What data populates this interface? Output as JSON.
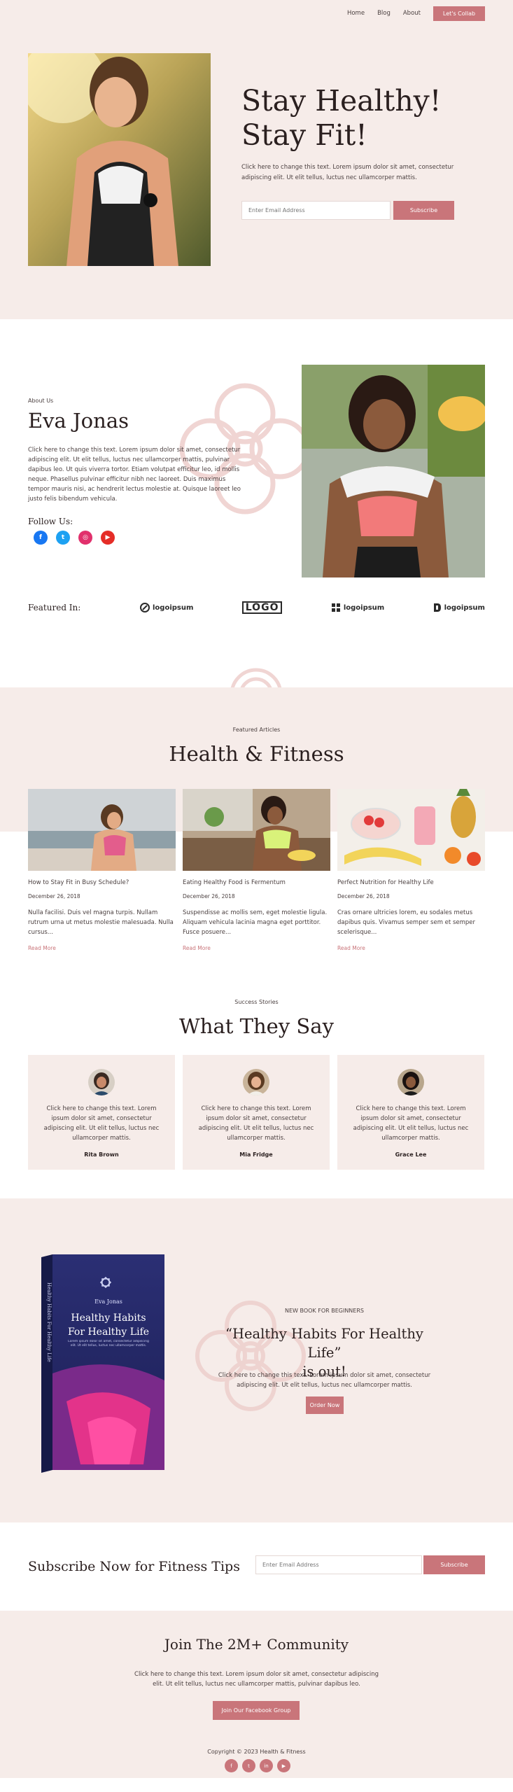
{
  "nav": {
    "links": [
      "Home",
      "Blog",
      "About"
    ],
    "cta": "Let's Collab"
  },
  "hero": {
    "title_line1": "Stay Healthy!",
    "title_line2": "Stay Fit!",
    "text": "Click here to change this text. Lorem ipsum dolor sit amet, consectetur adipiscing elit. Ut elit tellus, luctus nec ullamcorper mattis.",
    "email_placeholder": "Enter Email Address",
    "subscribe": "Subscribe"
  },
  "about": {
    "eyebrow": "About Us",
    "name": "Eva Jonas",
    "text": "Click here to change this text. Lorem ipsum dolor sit amet, consectetur adipiscing elit. Ut elit tellus, luctus nec ullamcorper mattis, pulvinar dapibus leo. Ut quis viverra tortor. Etiam volutpat efficitur leo, id mollis neque. Phasellus pulvinar efficitur nibh nec laoreet. Duis maximus tempor mauris nisi, ac hendrerit lectus molestie at. Quisque laoreet leo justo felis bibendum vehicula.",
    "follow": "Follow Us:",
    "socials": [
      {
        "icon": "facebook-icon",
        "glyph": "f",
        "color": "#1877f2"
      },
      {
        "icon": "twitter-icon",
        "glyph": "t",
        "color": "#1da1f2"
      },
      {
        "icon": "instagram-icon",
        "glyph": "◎",
        "color": "#e1306c"
      },
      {
        "icon": "youtube-icon",
        "glyph": "▶",
        "color": "#e52d27"
      }
    ]
  },
  "featured": {
    "label": "Featured In:",
    "logos": [
      "logoipsum",
      "LOGO",
      "logoipsum",
      "logoipsum"
    ]
  },
  "articles": {
    "eyebrow": "Featured Articles",
    "title": "Health & Fitness",
    "items": [
      {
        "title": "How to Stay Fit in Busy Schedule?",
        "date": "December 26, 2018",
        "excerpt": "Nulla facilisi. Duis vel magna turpis. Nullam rutrum urna ut metus molestie malesuada. Nulla cursus...",
        "more": "Read More"
      },
      {
        "title": "Eating Healthy Food is Fermentum",
        "date": "December 26, 2018",
        "excerpt": "Suspendisse ac mollis sem, eget molestie ligula. Aliquam vehicula lacinia magna eget porttitor. Fusce posuere...",
        "more": "Read More"
      },
      {
        "title": "Perfect Nutrition for Healthy Life",
        "date": "December 26, 2018",
        "excerpt": "Cras ornare ultricies lorem, eu sodales metus dapibus quis. Vivamus semper sem et semper scelerisque...",
        "more": "Read More"
      }
    ]
  },
  "testimonials": {
    "eyebrow": "Success Stories",
    "title": "What They Say",
    "items": [
      {
        "text": "Click here to change this text. Lorem ipsum dolor sit amet, consectetur adipiscing elit. Ut elit tellus, luctus nec ullamcorper mattis.",
        "name": "Rita Brown"
      },
      {
        "text": "Click here to change this text. Lorem ipsum dolor sit amet, consectetur adipiscing elit. Ut elit tellus, luctus nec ullamcorper mattis.",
        "name": "Mia Fridge"
      },
      {
        "text": "Click here to change this text. Lorem ipsum dolor sit amet, consectetur adipiscing elit. Ut elit tellus, luctus nec ullamcorper mattis.",
        "name": "Grace Lee"
      }
    ]
  },
  "book": {
    "eyebrow": "NEW BOOK FOR BEGINNERS",
    "title_line1": "“Healthy Habits For Healthy Life”",
    "title_line2": "is out!",
    "text": "Click here to change this text. Lorem ipsum dolor sit amet, consectetur adipiscing elit. Ut elit tellus, luctus nec ullamcorper mattis.",
    "cta": "Order Now",
    "cover_author": "Eva Jonas",
    "cover_title_line1": "Healthy Habits",
    "cover_title_line2": "For Healthy Life",
    "cover_sub": "Lorem ipsum dolor sit amet, consectetur adipiscing elit. Ut elit tellus, luctus nec ullamcorper mattis.",
    "spine": "Healthy Habits For Healthy Life"
  },
  "subscribe": {
    "title": "Subscribe Now for Fitness Tips",
    "placeholder": "Enter Email Address",
    "button": "Subscribe"
  },
  "footer": {
    "title": "Join The 2M+ Community",
    "text": "Click here to change this text. Lorem ipsum dolor sit amet, consectetur adipiscing elit. Ut elit tellus, luctus nec ullamcorper mattis, pulvinar dapibus leo.",
    "cta": "Join Our Facebook Group",
    "copyright": "Copyright © 2023 Health & Fitness",
    "socials": [
      {
        "icon": "facebook-icon",
        "glyph": "f"
      },
      {
        "icon": "twitter-icon",
        "glyph": "t"
      },
      {
        "icon": "linkedin-icon",
        "glyph": "in"
      },
      {
        "icon": "youtube-icon",
        "glyph": "▶"
      }
    ]
  },
  "colors": {
    "accent": "#c9757a",
    "blush": "#f6ece9"
  }
}
